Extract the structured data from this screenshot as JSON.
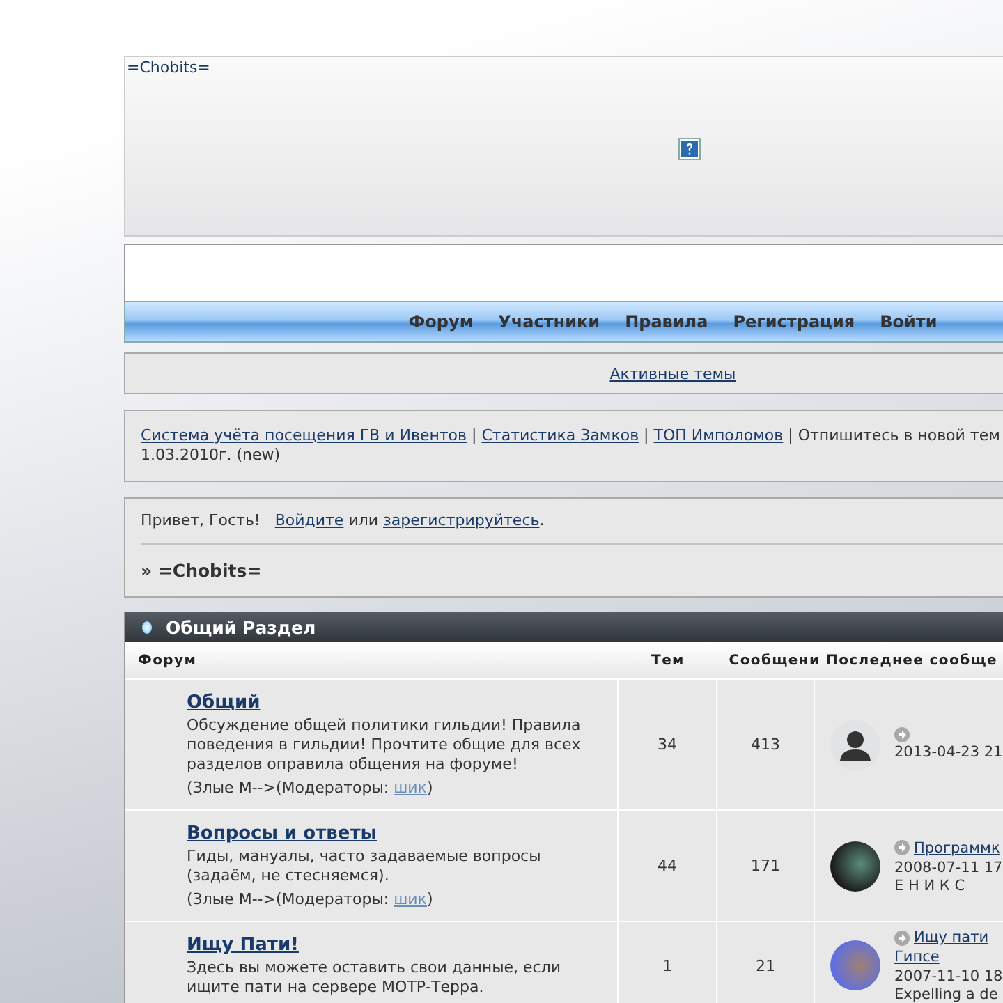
{
  "header": {
    "logo_text": "=Chobits="
  },
  "nav": [
    "Форум",
    "Участники",
    "Правила",
    "Регистрация",
    "Войти"
  ],
  "active_topics": "Активные темы",
  "announcement": {
    "items": [
      {
        "kind": "link",
        "text": "Система учёта посещения ГВ и Ивентов"
      },
      {
        "kind": "sep",
        "text": "|"
      },
      {
        "kind": "link",
        "text": "Статистика Замков"
      },
      {
        "kind": "sep",
        "text": "|"
      },
      {
        "kind": "link",
        "text": "ТОП Имполомов"
      },
      {
        "kind": "sep",
        "text": "|"
      },
      {
        "kind": "text",
        "text": "Отпишитесь в новой тем"
      }
    ],
    "continuation": "1.03.2010г. (new)"
  },
  "greeting": {
    "hello": "Привет, Гость!",
    "login": "Войдите",
    "or": "или",
    "register": "зарегистрируйтесь",
    "end": "."
  },
  "breadcrumb": "» =Chobits=",
  "category": {
    "title": "Общий Раздел",
    "columns": [
      "Форум",
      "Тем",
      "Сообщени",
      "Последнее сообще"
    ],
    "forums": [
      {
        "title": "Общий",
        "description": "Обсуждение общей политики гильдии! Правила поведения в гильдии! Прочтите общие для всех разделов оправила общения на форуме!",
        "moderators_label": "(Злые М-->(Модераторы:",
        "moderator": "шик",
        "moderators_end": ")",
        "topics": "34",
        "posts": "413",
        "last": {
          "kind": "silhouette",
          "date": "2013-04-23 21"
        }
      },
      {
        "title": "Вопросы и ответы",
        "description": "Гиды, мануалы, часто задаваемые вопросы (задаём, не стесняемся).",
        "moderators_label": "(Злые М-->(Модераторы:",
        "moderator": "шик",
        "moderators_end": ")",
        "topics": "44",
        "posts": "171",
        "last": {
          "kind": "picture",
          "link_lines": [
            "Программк"
          ],
          "date": "2008-07-11 17",
          "author": "Е Н И К С"
        }
      },
      {
        "title": "Ищу Пати!",
        "description": "Здесь вы можете оставить свои данные, если ищите пати на сервере МОТР-Терра.",
        "topics": "1",
        "posts": "21",
        "last": {
          "kind": "picture",
          "link_lines": [
            "Ищу пати",
            "Гипсе"
          ],
          "date": "2007-11-10 18",
          "author": "Expelling a de"
        }
      }
    ]
  }
}
